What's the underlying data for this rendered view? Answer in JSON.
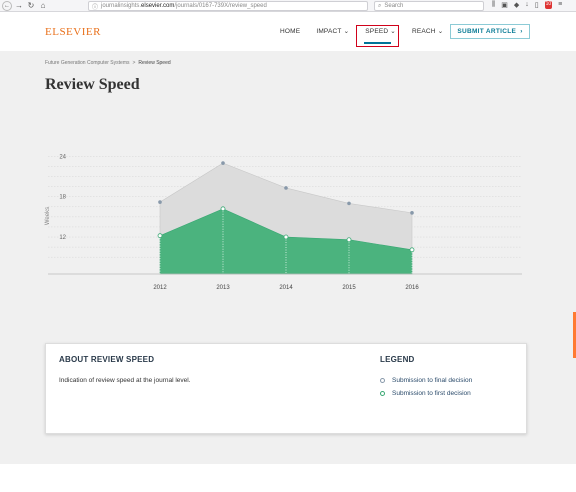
{
  "browser": {
    "url_prefix": "journalinsights.",
    "url_domain": "elsevier.com",
    "url_path": "/journals/0167-739X/review_speed",
    "search_placeholder": "Search",
    "badge": "10"
  },
  "header": {
    "logo": "ELSEVIER",
    "nav": {
      "home": "HOME",
      "impact": "IMPACT",
      "speed": "SPEED",
      "reach": "REACH"
    },
    "submit_label": "SUBMIT ARTICLE",
    "colors": {
      "logo": "#e9711c",
      "highlight_box": "#d0021b",
      "accent": "#0c7c96"
    }
  },
  "breadcrumb": {
    "parent": "Future Generation Computer Systems",
    "separator": ">",
    "current": "Review Speed"
  },
  "page_title": "Review Speed",
  "chart_data": {
    "type": "area",
    "x": [
      "2012",
      "2013",
      "2014",
      "2015",
      "2016"
    ],
    "ylabel": "Weeks",
    "yticks": [
      12,
      18,
      24
    ],
    "ylim": [
      6.5,
      24.5
    ],
    "grid": true,
    "series": [
      {
        "name": "Submission to final decision",
        "values": [
          17.2,
          23.0,
          19.3,
          17.0,
          15.6
        ],
        "color": "#dcdcdc"
      },
      {
        "name": "Submission to first decision",
        "values": [
          12.2,
          16.2,
          12.0,
          11.6,
          10.1
        ],
        "color": "#4bb37e"
      }
    ]
  },
  "info": {
    "title": "ABOUT REVIEW SPEED",
    "text": "Indication of review speed at the journal level."
  },
  "legend": {
    "title": "LEGEND",
    "items": [
      "Submission to final decision",
      "Submission to first decision"
    ]
  }
}
